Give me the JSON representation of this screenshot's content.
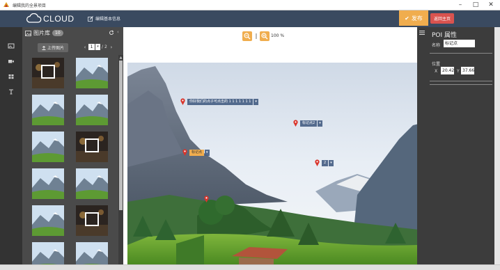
{
  "window": {
    "title": "编辑我的全景项目",
    "minimize": "–",
    "maximize": "□",
    "close": "✕"
  },
  "header": {
    "logo_text": "CLOUD",
    "edit_label": "编辑基本信息",
    "publish_label": "发布",
    "exit_label": "返回主页"
  },
  "rail": {
    "icons": [
      "image-icon",
      "video-icon",
      "grid-icon",
      "text-icon"
    ]
  },
  "panel": {
    "title": "图片库",
    "count": "10",
    "upload_label": "上传图片",
    "page_current": "1",
    "page_total": "2",
    "prev": "‹",
    "next": "›",
    "dropdown": "▾"
  },
  "toolbar": {
    "zoom_separator": "|",
    "zoom_value": "100 %"
  },
  "markers": [
    {
      "label": "你好我们的点子可点击的 1 1 1 1 1 1 1",
      "selected": false
    },
    {
      "label": "标记点2",
      "selected": false
    },
    {
      "label": "标记点",
      "selected": true
    },
    {
      "label": "2",
      "selected": false
    },
    {
      "label": "",
      "selected": false
    }
  ],
  "marker_caret": "▾",
  "poi": {
    "title": "POI 属性",
    "name_label": "名称",
    "name_value": "标记点",
    "position_label": "位置",
    "x_label": "X",
    "x_value": "20.42",
    "y_label": "Y",
    "y_value": "37.66"
  },
  "colors": {
    "topbar": "#3a4a60",
    "accent": "#f0ad4e",
    "danger": "#d9534f"
  }
}
